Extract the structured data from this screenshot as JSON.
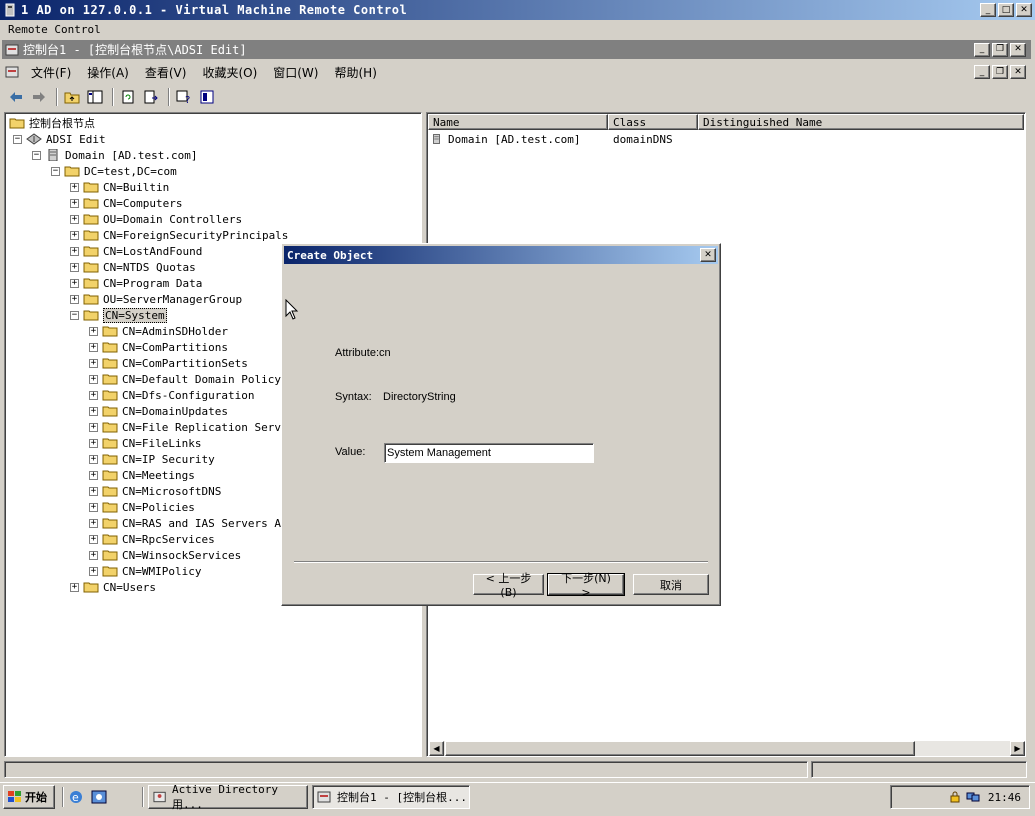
{
  "vm_window": {
    "title": "1 AD on 127.0.0.1 - Virtual Machine Remote Control",
    "menu": [
      "Remote Control"
    ]
  },
  "mmc": {
    "title": "控制台1 - [控制台根节点\\ADSI Edit]",
    "menu": [
      "文件(F)",
      "操作(A)",
      "查看(V)",
      "收藏夹(O)",
      "窗口(W)",
      "帮助(H)"
    ]
  },
  "tree": {
    "root": "控制台根节点",
    "adsi": "ADSI Edit",
    "domain": "Domain [AD.test.com]",
    "dc": "DC=test,DC=com",
    "level1": [
      "CN=Builtin",
      "CN=Computers",
      "OU=Domain Controllers",
      "CN=ForeignSecurityPrincipals",
      "CN=LostAndFound",
      "CN=NTDS Quotas",
      "CN=Program Data",
      "OU=ServerManagerGroup"
    ],
    "system": "CN=System",
    "system_children": [
      "CN=AdminSDHolder",
      "CN=ComPartitions",
      "CN=ComPartitionSets",
      "CN=Default Domain Policy",
      "CN=Dfs-Configuration",
      "CN=DomainUpdates",
      "CN=File Replication Servic",
      "CN=FileLinks",
      "CN=IP Security",
      "CN=Meetings",
      "CN=MicrosoftDNS",
      "CN=Policies",
      "CN=RAS and IAS Servers Acc",
      "CN=RpcServices",
      "CN=WinsockServices",
      "CN=WMIPolicy"
    ],
    "users": "CN=Users"
  },
  "list": {
    "columns": [
      "Name",
      "Class",
      "Distinguished Name"
    ],
    "rows": [
      {
        "name": "Domain [AD.test.com]",
        "class": "domainDNS",
        "dn": ""
      }
    ]
  },
  "dialog": {
    "title": "Create Object",
    "attribute_label": "Attribute:",
    "attribute_value": "cn",
    "syntax_label": "Syntax:",
    "syntax_value": "DirectoryString",
    "value_label": "Value:",
    "value": "System Management",
    "back_label": "< 上一步(B)",
    "next_label": "下一步(N) >",
    "cancel_label": "取消"
  },
  "taskbar": {
    "start_label": "开始",
    "tasks": [
      "Active Directory 用...",
      "控制台1 - [控制台根..."
    ],
    "clock": "21:46"
  },
  "colors": {
    "title_active": "#0a246a",
    "title_inactive": "#808080",
    "face": "#d4d0c8",
    "folder": "#f2d26a"
  }
}
